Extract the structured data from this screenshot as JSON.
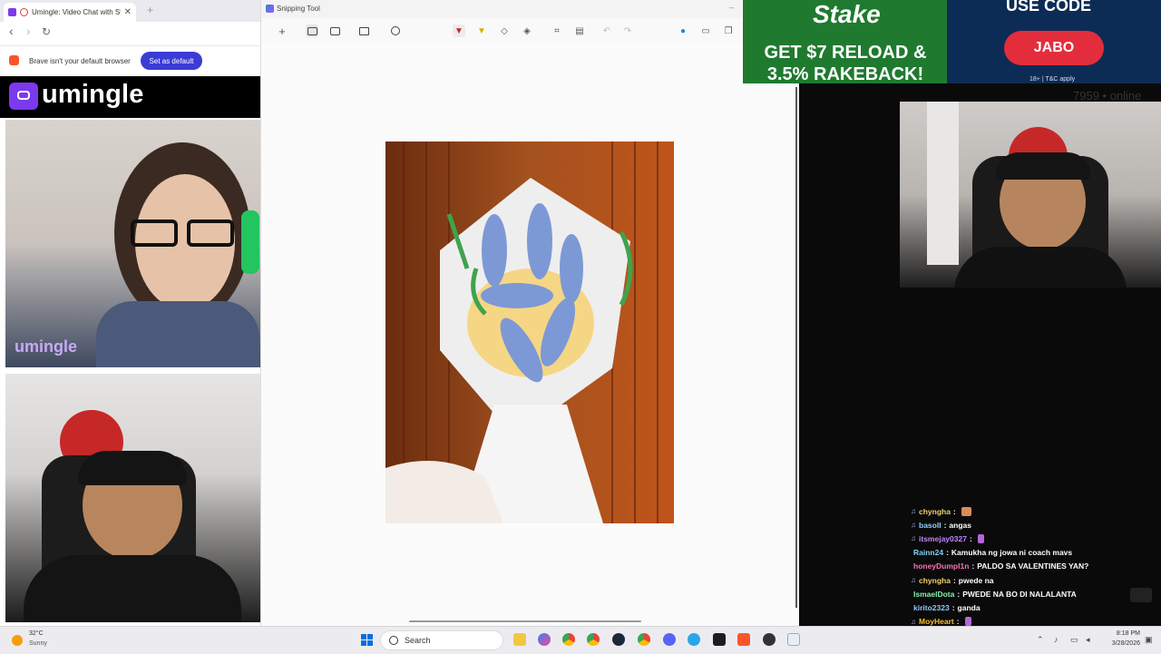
{
  "browser": {
    "tab_title": "Umingle: Video Chat with Str",
    "new_tab": "+",
    "nav_back": "‹",
    "nav_forward": "›",
    "nav_reload": "↻",
    "infobar_text": "Brave isn't your default browser",
    "set_default": "Set as default"
  },
  "umingle": {
    "logo_text": "umingle",
    "watermark": "umingle"
  },
  "snipping": {
    "title": "Snipping Tool"
  },
  "ad": {
    "brand": "Stake",
    "headline": "GET $7 RELOAD & 3.5% RAKEBACK!",
    "use_code": "USE CODE",
    "code": "JABO",
    "terms": "18+ | T&C apply"
  },
  "stream": {
    "online": "7959 • online"
  },
  "chat": [
    {
      "user": "chyngha",
      "msg": "",
      "emote": "brown",
      "color": "#f2d06b"
    },
    {
      "user": "basoll",
      "msg": "angas",
      "emote": "",
      "color": "#8fd3ff"
    },
    {
      "user": "itsmejay0327",
      "msg": "",
      "emote": "purple",
      "color": "#c084fc"
    },
    {
      "user": "Rainn24",
      "msg": "Kamukha ng jowa ni coach mavs",
      "emote": "",
      "color": "#7dd3fc"
    },
    {
      "user": "honeyDumpl1n",
      "msg": "PALDO SA VALENTINES YAN?",
      "emote": "",
      "color": "#f472b6"
    },
    {
      "user": "chyngha",
      "msg": "pwede na",
      "emote": "",
      "color": "#f2d06b"
    },
    {
      "user": "IsmaelDota",
      "msg": "PWEDE NA BO DI NALALANTA",
      "emote": "",
      "color": "#86efac"
    },
    {
      "user": "kirito2323",
      "msg": "ganda",
      "emote": "",
      "color": "#93c5fd"
    },
    {
      "user": "MoyHeart",
      "msg": "",
      "emote": "purple",
      "color": "#fbbf24"
    }
  ],
  "taskbar": {
    "weather_temp": "32°C",
    "weather_desc": "Sunny",
    "search": "Search",
    "time": "8:18 PM",
    "date": "3/28/2026"
  }
}
